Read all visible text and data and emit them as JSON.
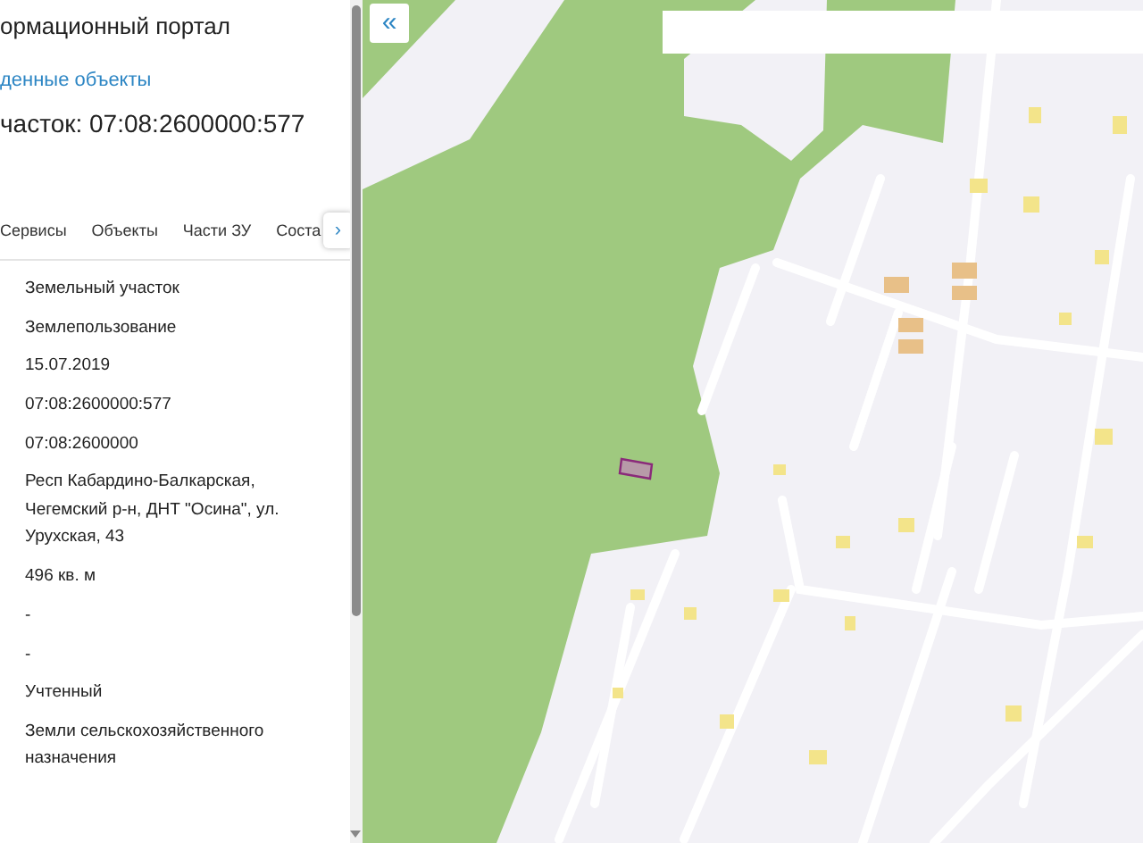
{
  "panel": {
    "portal_title": "ормационный портал",
    "found_link": "денные объекты",
    "heading": "часток: 07:08:2600000:577",
    "tabs": [
      {
        "label": "Сервисы",
        "selected": false
      },
      {
        "label": "Объекты",
        "selected": false
      },
      {
        "label": "Части ЗУ",
        "selected": false
      },
      {
        "label": "Соста",
        "selected": false
      }
    ],
    "tab_scroll": "›",
    "values": [
      "Земельный участок",
      "Землепользование",
      "15.07.2019",
      "07:08:2600000:577",
      "07:08:2600000",
      "Респ Кабардино-Балкарская, Чегемский р-н, ДНТ \"Осина\", ул. Урухская, 43",
      "496 кв. м",
      "-",
      "-",
      "Учтенный",
      "Земли сельскохозяйственного назначения"
    ]
  },
  "map": {
    "collapse_button": "«"
  }
}
